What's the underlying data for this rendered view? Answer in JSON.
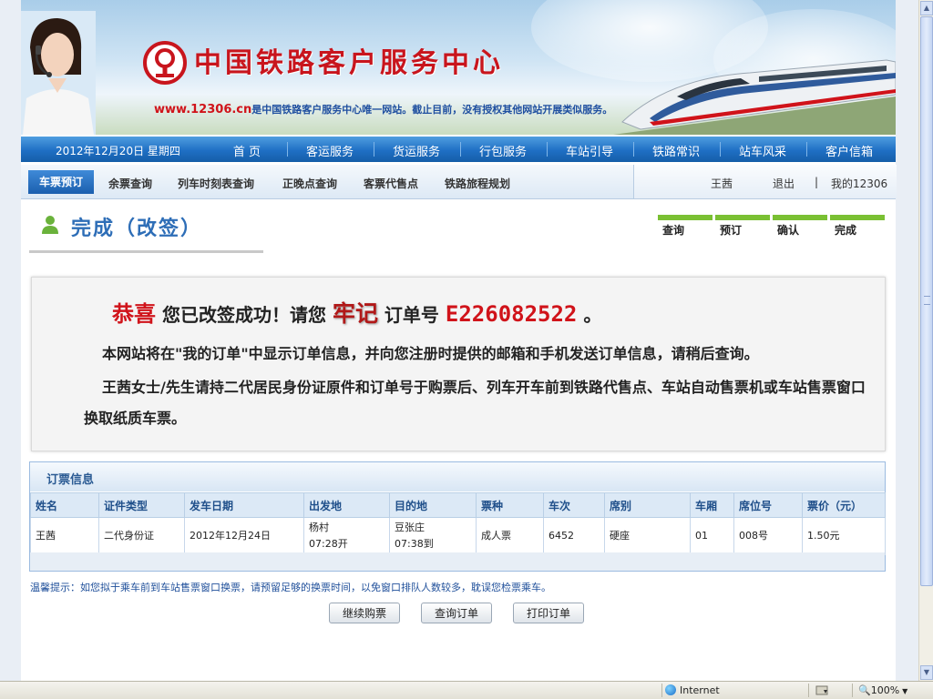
{
  "banner": {
    "brand_title": "中国铁路客户服务中心",
    "notice_url": "www.12306.cn",
    "notice_text": "是中国铁路客户服务中心唯一网站。截止目前，没有授权其他网站开展类似服务。"
  },
  "main_nav": {
    "date": "2012年12月20日 星期四",
    "items": [
      "首 页",
      "客运服务",
      "货运服务",
      "行包服务",
      "车站引导",
      "铁路常识",
      "站车风采",
      "客户信箱"
    ]
  },
  "sub_nav": {
    "active": "车票预订",
    "items": [
      "余票查询",
      "列车时刻表查询",
      "正晚点查询",
      "客票代售点",
      "铁路旅程规划"
    ],
    "user_name": "王茜",
    "logout": "退出",
    "separator": "|",
    "my_account": "我的12306"
  },
  "page": {
    "title": "完成（改签）"
  },
  "steps": [
    "查询",
    "预订",
    "确认",
    "完成"
  ],
  "success": {
    "congrats": "恭喜",
    "message_a": "您已改签成功！请您",
    "remember": "牢记",
    "message_b": "订单号",
    "order_number": "E226082522",
    "message_end": "。",
    "info_line_1": "本网站将在\"我的订单\"中显示订单信息，并向您注册时提供的邮箱和手机发送订单信息，请稍后查询。",
    "info_line_2": "王茜女士/先生请持二代居民身份证原件和订单号于购票后、列车开车前到铁路代售点、车站自动售票机或车站售票窗口换取纸质车票。"
  },
  "ticket_info": {
    "title": "订票信息",
    "columns": [
      "姓名",
      "证件类型",
      "发车日期",
      "出发地",
      "目的地",
      "票种",
      "车次",
      "席别",
      "车厢",
      "席位号",
      "票价（元）"
    ],
    "row": {
      "name": "王茜",
      "id_type": "二代身份证",
      "date": "2012年12月24日",
      "from_station": "杨村",
      "from_time": "07:28开",
      "to_station": "豆张庄",
      "to_time": "07:38到",
      "ticket_type": "成人票",
      "train_no": "6452",
      "seat_class": "硬座",
      "coach": "01",
      "seat_no": "008号",
      "price": "1.50元"
    }
  },
  "tip": "温馨提示：如您拟于乘车前到车站售票窗口换票，请预留足够的换票时间，以免窗口排队人数较多，耽误您检票乘车。",
  "buttons": {
    "continue": "继续购票",
    "query": "查询订单",
    "print": "打印订单"
  },
  "statusbar": {
    "zone": "Internet",
    "zoom": "100%"
  },
  "colors": {
    "brand_red": "#c8151d",
    "nav_blue": "#1f6fc4",
    "step_green": "#7ac033",
    "title_blue": "#2e6eb7"
  }
}
